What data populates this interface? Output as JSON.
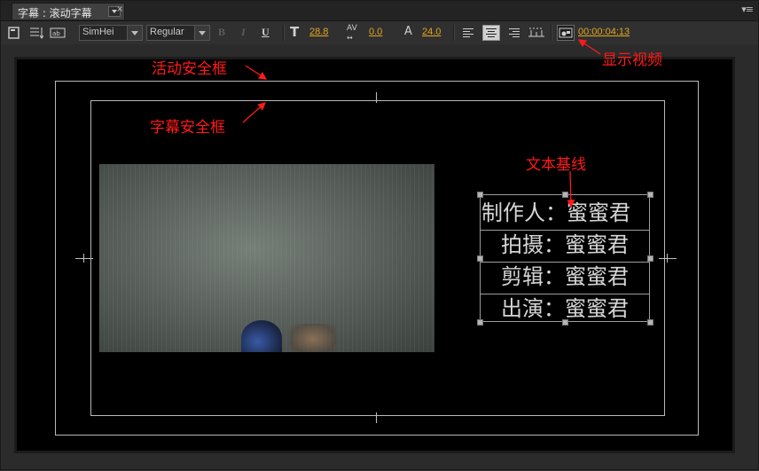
{
  "tab": {
    "title": "字幕 : 滚动字幕",
    "close_glyph": "×"
  },
  "panel_menu_glyph": "▾≡",
  "toolbar": {
    "font_family": "SimHei",
    "font_style": "Regular",
    "bold_label": "B",
    "italic_label": "I",
    "underline_label": "U",
    "font_size": "28.8",
    "kerning": "0.0",
    "leading": "24.0",
    "timecode": "00:00:04:13",
    "size_icon_label": "T",
    "kerning_icon_label": "AV",
    "leading_icon_label": "A"
  },
  "title_lines": [
    "制作人：蜜蜜君",
    "拍摄：蜜蜜君",
    "剪辑：蜜蜜君",
    "出演：蜜蜜君"
  ],
  "annotations": {
    "show_video": "显示视频",
    "action_safe": "活动安全框",
    "title_safe": "字幕安全框",
    "text_baseline": "文本基线"
  },
  "colors": {
    "annotation": "#ff1a1a",
    "value_link": "#e3a61c",
    "panel_bg": "#2b2b2b"
  }
}
